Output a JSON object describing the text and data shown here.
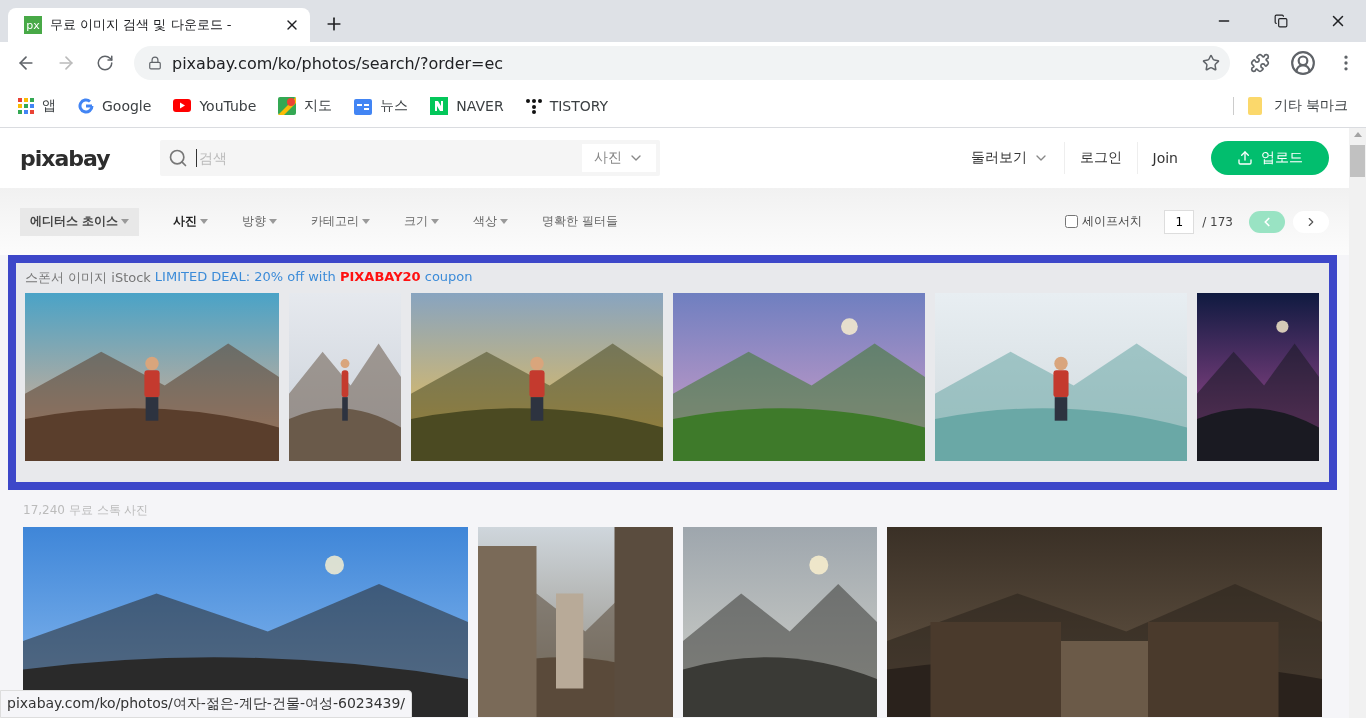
{
  "browser": {
    "tab": {
      "favicon": "px",
      "title": "무료 이미지 검색 및 다운로드 -",
      "selected": true
    },
    "address": "pixabay.com/ko/photos/search/?order=ec",
    "forward_disabled": true,
    "bookmarks": [
      {
        "kind": "apps",
        "label": "앱"
      },
      {
        "kind": "google",
        "label": "Google"
      },
      {
        "kind": "youtube",
        "label": "YouTube"
      },
      {
        "kind": "maps",
        "label": "지도"
      },
      {
        "kind": "news",
        "label": "뉴스"
      },
      {
        "kind": "naver",
        "label": "NAVER"
      },
      {
        "kind": "tistory",
        "label": "TISTORY"
      }
    ],
    "other_bookmarks": "기타 북마크",
    "status_url": "pixabay.com/ko/photos/여자-젊은-계단-건물-여성-6023439/"
  },
  "site": {
    "logo": "pixabay",
    "search": {
      "placeholder": "검색",
      "type": "사진"
    },
    "nav": [
      {
        "label": "둘러보기",
        "dropdown": true
      },
      {
        "label": "로그인",
        "dropdown": false
      },
      {
        "label": "Join",
        "dropdown": false
      }
    ],
    "upload": "업로드",
    "editors_choice": {
      "label": "에디터스 초이스",
      "active": true
    },
    "filters": [
      {
        "label": "사진",
        "selected": true,
        "dropdown": true
      },
      {
        "label": "방향",
        "selected": false,
        "dropdown": true
      },
      {
        "label": "카테고리",
        "selected": false,
        "dropdown": true
      },
      {
        "label": "크기",
        "selected": false,
        "dropdown": true
      },
      {
        "label": "색상",
        "selected": false,
        "dropdown": true
      },
      {
        "label": "명확한 필터들",
        "selected": false,
        "dropdown": false
      }
    ],
    "safesearch": {
      "label": "세이프서치",
      "checked": false
    },
    "pagination": {
      "page": "1",
      "total": "/ 173",
      "prev_disabled": true
    },
    "sponsor": {
      "label": "스폰서 이미지 iStock",
      "offer": "LIMITED DEAL: 20% off with **PIXABAY20** coupon",
      "images": [
        {
          "kind": "figure-picture"
        },
        {
          "kind": "figure-picture"
        },
        {
          "kind": "figure-picture"
        },
        {
          "kind": "landscape-picture"
        },
        {
          "kind": "figure-picture"
        },
        {
          "kind": "landscape-picture"
        }
      ]
    },
    "results": {
      "count": "17,240 무료 스톡 사진",
      "images": [
        {
          "kind": "landscape-picture"
        },
        {
          "kind": "picture"
        },
        {
          "kind": "landscape-picture"
        },
        {
          "kind": "room-picture"
        }
      ]
    }
  }
}
